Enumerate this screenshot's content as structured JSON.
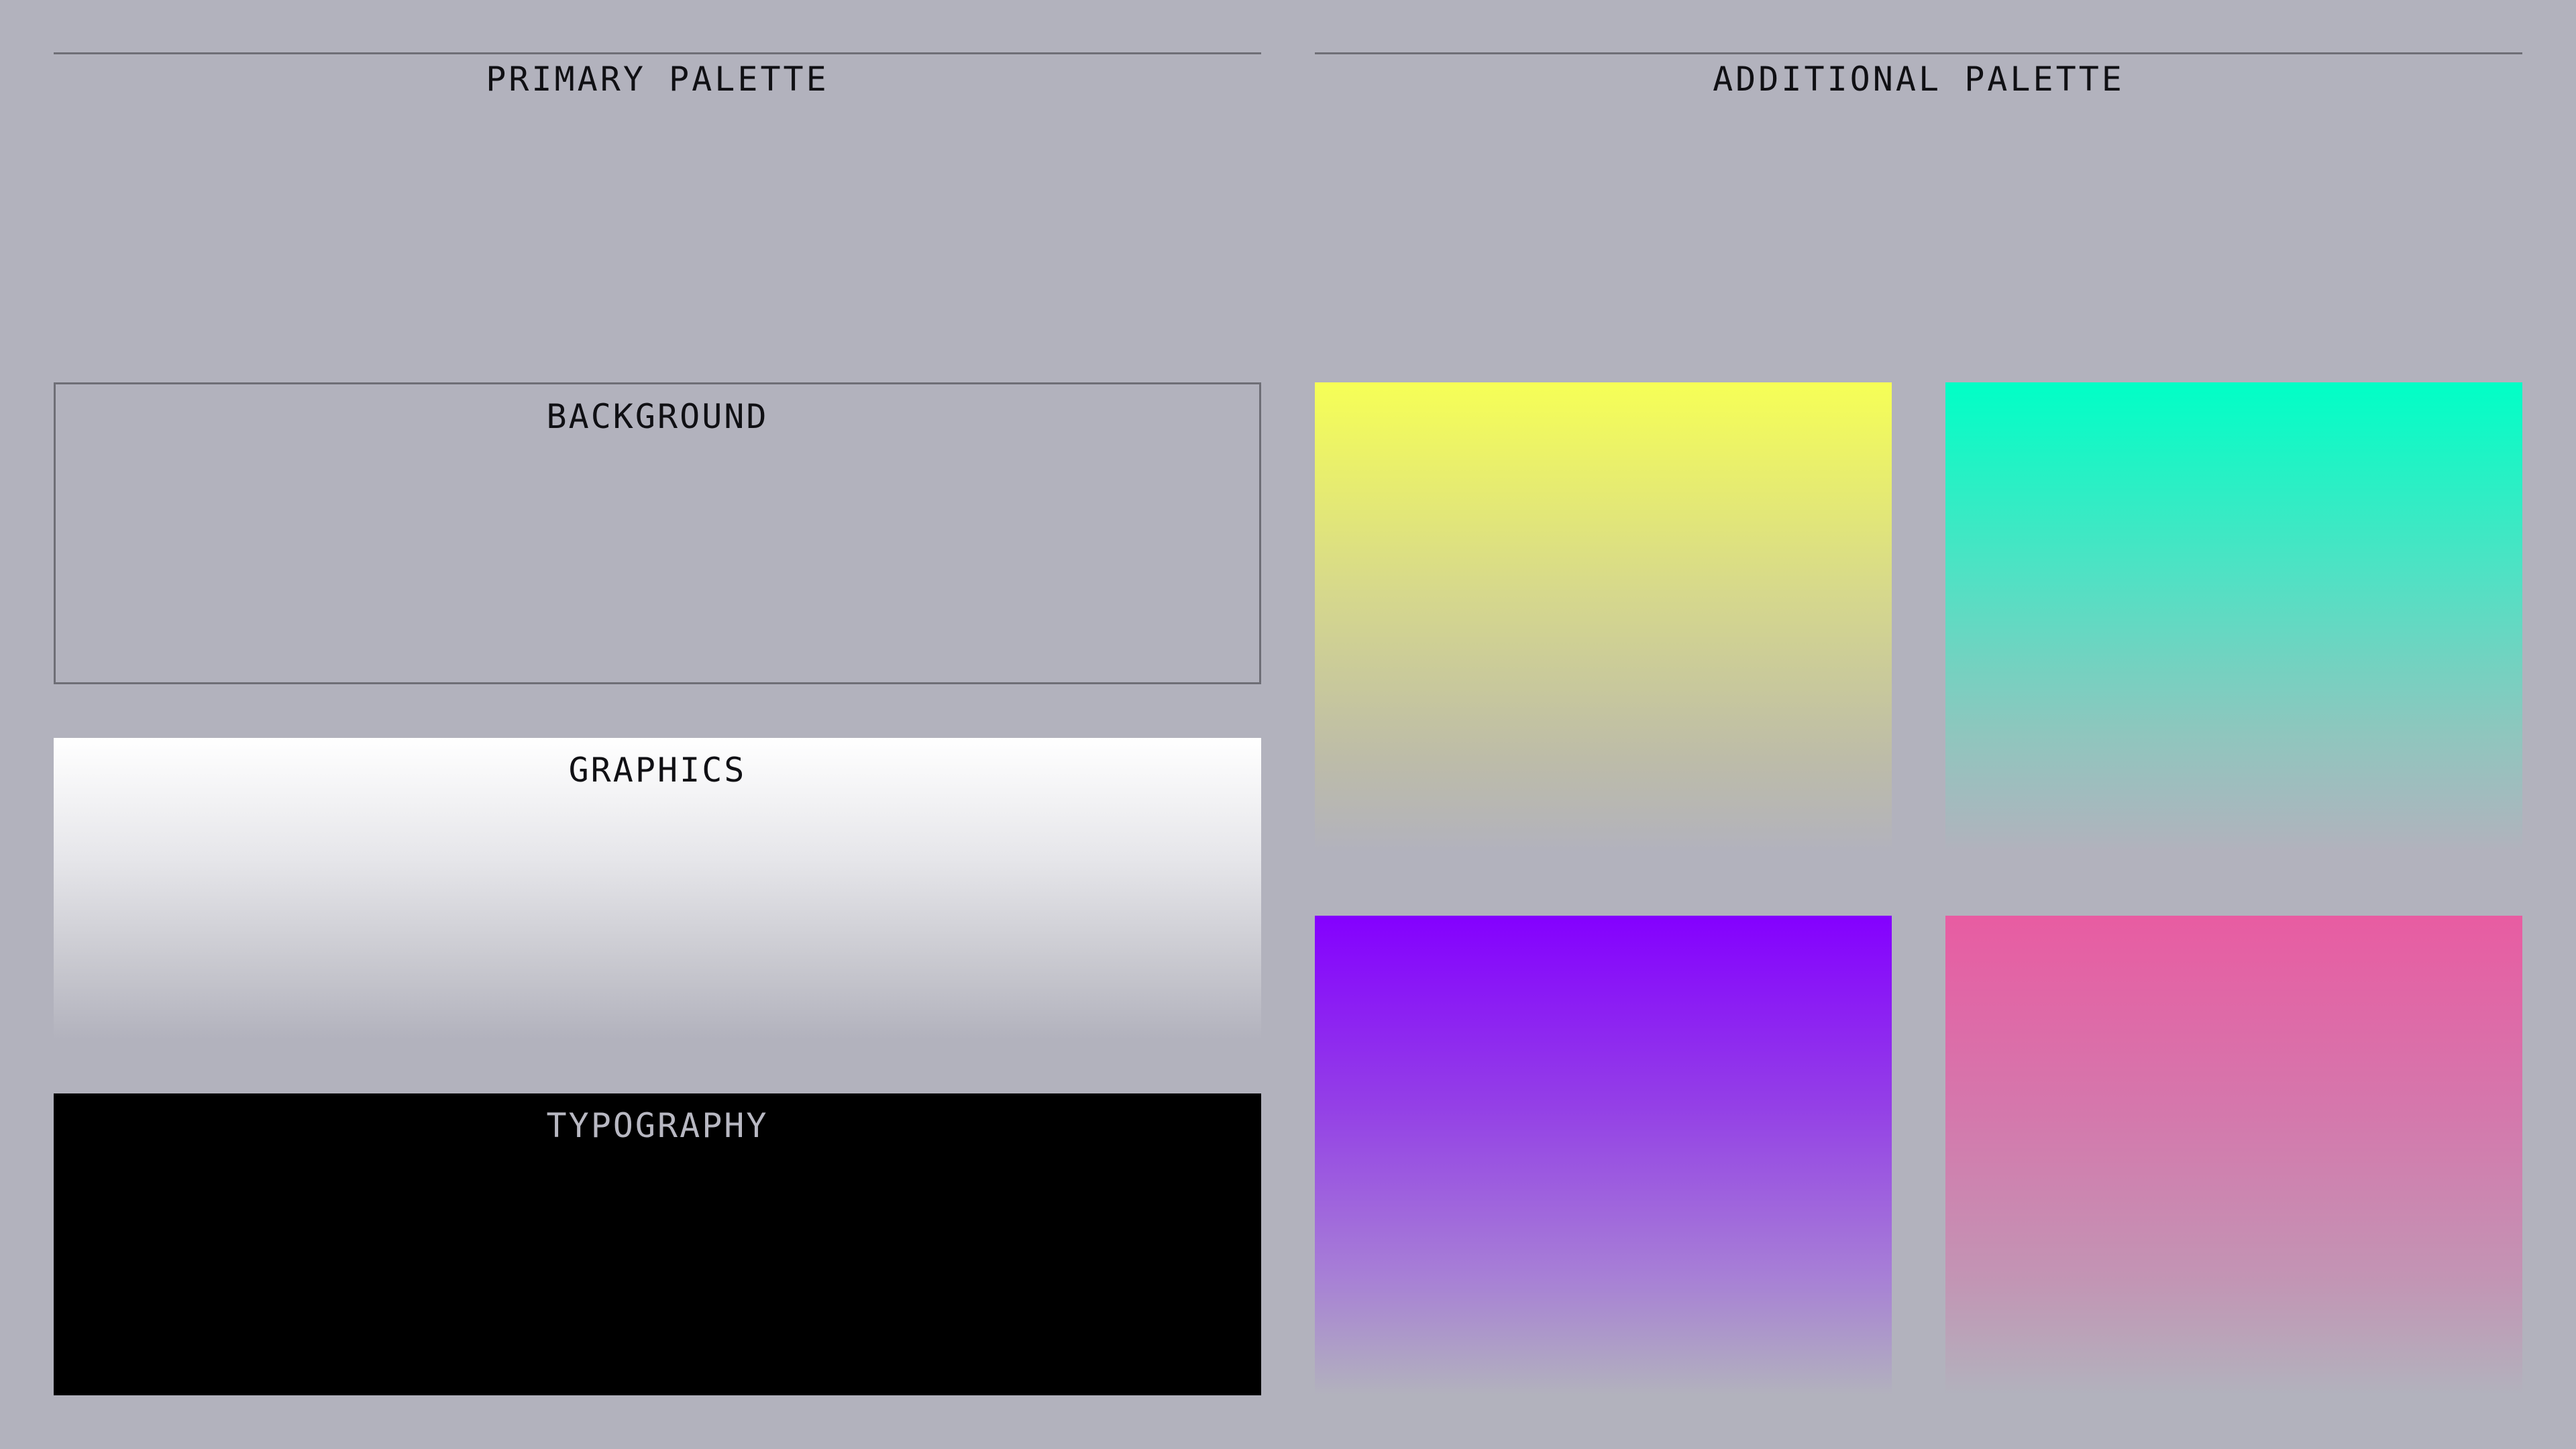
{
  "primary": {
    "title": "PRIMARY PALETTE",
    "swatches": [
      {
        "label": "BACKGROUND",
        "color": "#b2b2bd"
      },
      {
        "label": "GRAPHICS",
        "color": "#ffffff"
      },
      {
        "label": "TYPOGRAPHY",
        "color": "#000000"
      }
    ]
  },
  "additional": {
    "title": "ADDITIONAL PALETTE",
    "swatches": [
      {
        "color": "#f6ff56"
      },
      {
        "color": "#00ffc6"
      },
      {
        "color": "#8400ff"
      },
      {
        "color": "#e85ca2"
      }
    ]
  },
  "colors": {
    "page_background": "#b2b2bd",
    "rule": "#6e6e76",
    "text": "#101014"
  }
}
